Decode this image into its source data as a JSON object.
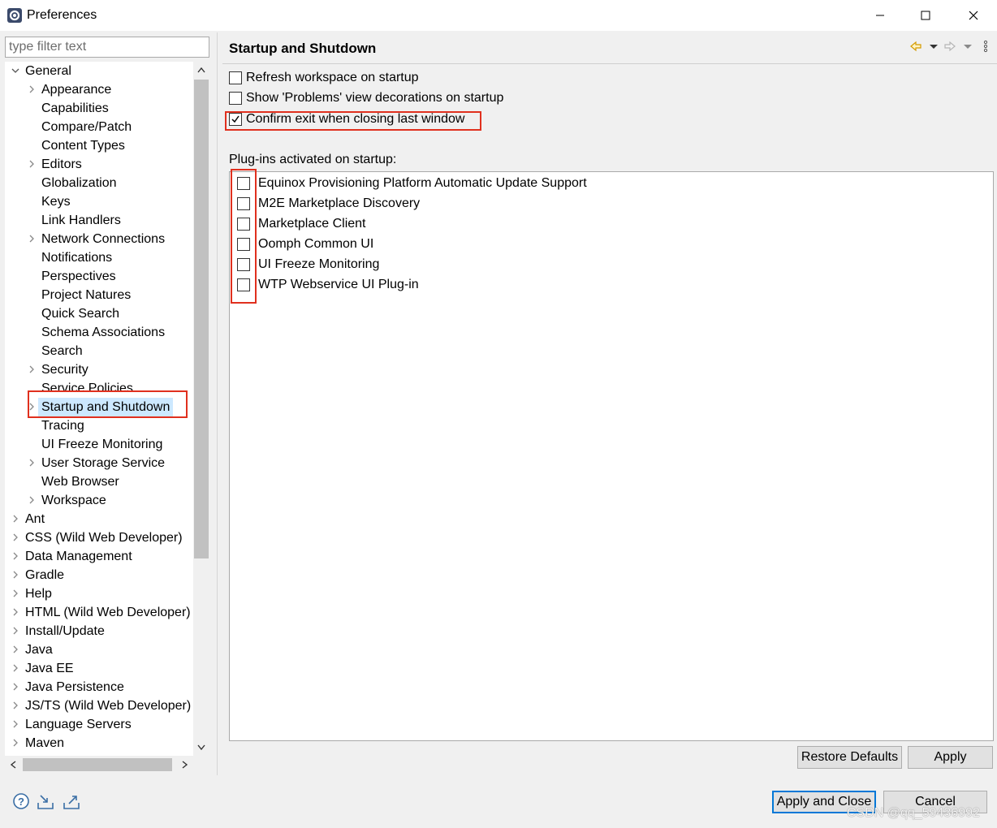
{
  "window": {
    "title": "Preferences",
    "controls": [
      "minimize",
      "maximize",
      "close"
    ]
  },
  "filter": {
    "placeholder": "type filter text",
    "value": ""
  },
  "tree": {
    "items": [
      {
        "label": "General",
        "level": 0,
        "expander": "expanded"
      },
      {
        "label": "Appearance",
        "level": 1,
        "expander": "collapsed"
      },
      {
        "label": "Capabilities",
        "level": 1,
        "expander": "none"
      },
      {
        "label": "Compare/Patch",
        "level": 1,
        "expander": "none"
      },
      {
        "label": "Content Types",
        "level": 1,
        "expander": "none"
      },
      {
        "label": "Editors",
        "level": 1,
        "expander": "collapsed"
      },
      {
        "label": "Globalization",
        "level": 1,
        "expander": "none"
      },
      {
        "label": "Keys",
        "level": 1,
        "expander": "none"
      },
      {
        "label": "Link Handlers",
        "level": 1,
        "expander": "none"
      },
      {
        "label": "Network Connections",
        "level": 1,
        "expander": "collapsed"
      },
      {
        "label": "Notifications",
        "level": 1,
        "expander": "none"
      },
      {
        "label": "Perspectives",
        "level": 1,
        "expander": "none"
      },
      {
        "label": "Project Natures",
        "level": 1,
        "expander": "none"
      },
      {
        "label": "Quick Search",
        "level": 1,
        "expander": "none"
      },
      {
        "label": "Schema Associations",
        "level": 1,
        "expander": "none"
      },
      {
        "label": "Search",
        "level": 1,
        "expander": "none"
      },
      {
        "label": "Security",
        "level": 1,
        "expander": "collapsed"
      },
      {
        "label": "Service Policies",
        "level": 1,
        "expander": "none"
      },
      {
        "label": "Startup and Shutdown",
        "level": 1,
        "expander": "collapsed",
        "selected": true
      },
      {
        "label": "Tracing",
        "level": 1,
        "expander": "none"
      },
      {
        "label": "UI Freeze Monitoring",
        "level": 1,
        "expander": "none"
      },
      {
        "label": "User Storage Service",
        "level": 1,
        "expander": "collapsed"
      },
      {
        "label": "Web Browser",
        "level": 1,
        "expander": "none"
      },
      {
        "label": "Workspace",
        "level": 1,
        "expander": "collapsed"
      },
      {
        "label": "Ant",
        "level": 0,
        "expander": "collapsed"
      },
      {
        "label": "CSS (Wild Web Developer)",
        "level": 0,
        "expander": "collapsed"
      },
      {
        "label": "Data Management",
        "level": 0,
        "expander": "collapsed"
      },
      {
        "label": "Gradle",
        "level": 0,
        "expander": "collapsed"
      },
      {
        "label": "Help",
        "level": 0,
        "expander": "collapsed"
      },
      {
        "label": "HTML (Wild Web Developer)",
        "level": 0,
        "expander": "collapsed"
      },
      {
        "label": "Install/Update",
        "level": 0,
        "expander": "collapsed"
      },
      {
        "label": "Java",
        "level": 0,
        "expander": "collapsed"
      },
      {
        "label": "Java EE",
        "level": 0,
        "expander": "collapsed"
      },
      {
        "label": "Java Persistence",
        "level": 0,
        "expander": "collapsed"
      },
      {
        "label": "JS/TS (Wild Web Developer)",
        "level": 0,
        "expander": "collapsed"
      },
      {
        "label": "Language Servers",
        "level": 0,
        "expander": "collapsed"
      },
      {
        "label": "Maven",
        "level": 0,
        "expander": "collapsed"
      }
    ]
  },
  "page": {
    "title": "Startup and Shutdown",
    "options": [
      {
        "label": "Refresh workspace on startup",
        "checked": false
      },
      {
        "label": "Show 'Problems' view decorations on startup",
        "checked": false
      },
      {
        "label": "Confirm exit when closing last window",
        "checked": true
      }
    ],
    "plugins_label": "Plug-ins activated on startup:",
    "plugins": [
      {
        "label": "Equinox Provisioning Platform Automatic Update Support",
        "checked": false
      },
      {
        "label": "M2E Marketplace Discovery",
        "checked": false
      },
      {
        "label": "Marketplace Client",
        "checked": false
      },
      {
        "label": "Oomph Common UI",
        "checked": false
      },
      {
        "label": "UI Freeze Monitoring",
        "checked": false
      },
      {
        "label": "WTP Webservice UI Plug-in",
        "checked": false
      }
    ],
    "restore_defaults_label": "Restore Defaults",
    "apply_label": "Apply"
  },
  "footer": {
    "apply_and_close_label": "Apply and Close",
    "cancel_label": "Cancel",
    "icons": [
      "help-icon",
      "import-icon",
      "export-icon"
    ]
  },
  "watermark": "CSDN @qq_59436992",
  "colors": {
    "selection": "#cce8ff",
    "annotation_red": "#e0301e",
    "default_button_border": "#0078d7"
  }
}
